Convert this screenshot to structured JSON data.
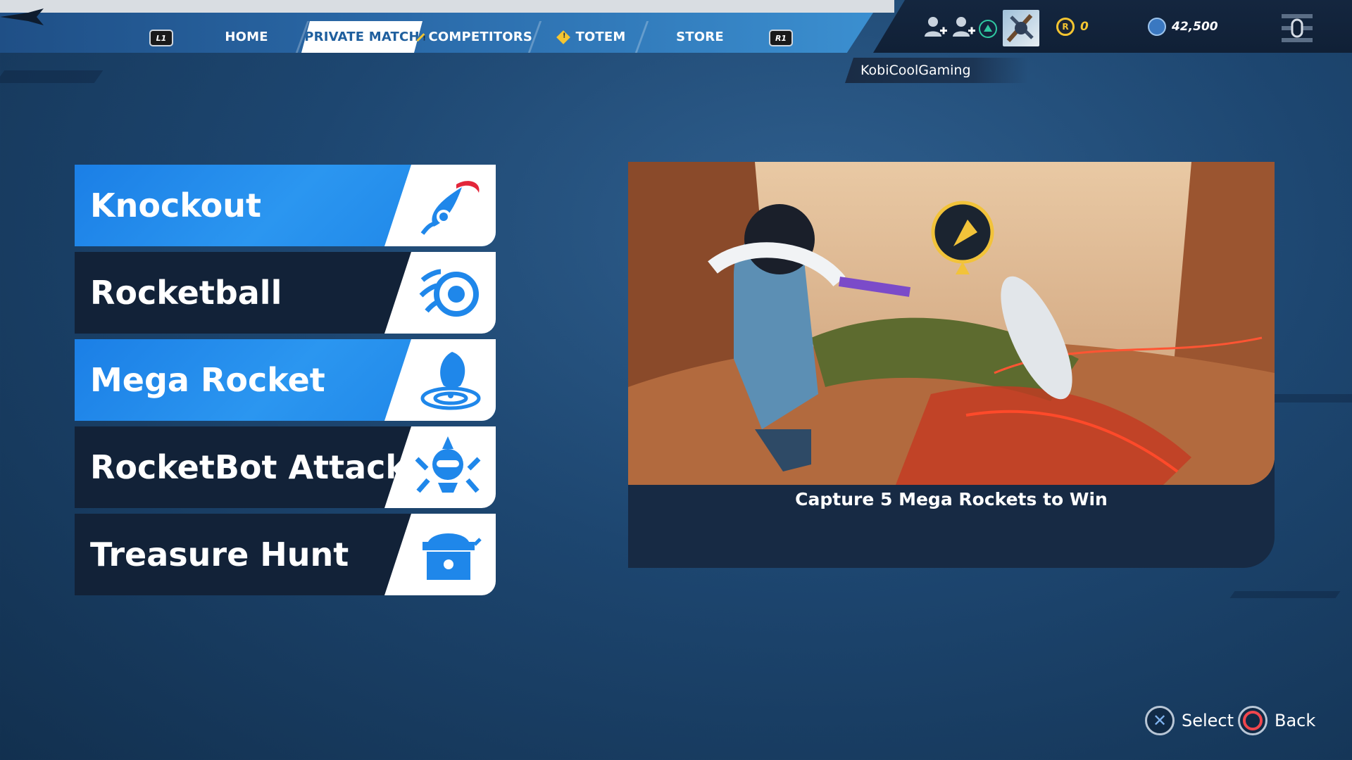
{
  "nav": {
    "left_shoulder": "L1",
    "right_shoulder": "R1",
    "tabs": [
      {
        "label": "HOME"
      },
      {
        "label": "PRIVATE MATCH"
      },
      {
        "label": "COMPETITORS"
      },
      {
        "label": "TOTEM"
      },
      {
        "label": "STORE"
      }
    ]
  },
  "status": {
    "coins": "0",
    "gems": "42,500",
    "player_name": "KobiCoolGaming"
  },
  "modes": [
    {
      "label": "Knockout",
      "icon": "knockout-rocket-icon"
    },
    {
      "label": "Rocketball",
      "icon": "rocketball-icon"
    },
    {
      "label": "Mega Rocket",
      "icon": "mega-rocket-icon"
    },
    {
      "label": "RocketBot Attack",
      "icon": "rocketbot-icon"
    },
    {
      "label": "Treasure Hunt",
      "icon": "treasure-chest-icon"
    }
  ],
  "selected_mode": "Mega Rocket",
  "preview": {
    "caption": "Capture 5 Mega Rockets to Win"
  },
  "footer": {
    "select_label": "Select",
    "back_label": "Back"
  },
  "colors": {
    "accent_blue": "#1f87ea",
    "panel_dark": "#122238",
    "cross_blue": "#7fb2ee",
    "circle_red": "#f0464d",
    "triangle_green": "#2fc7a0",
    "coin_gold": "#f4c531"
  }
}
